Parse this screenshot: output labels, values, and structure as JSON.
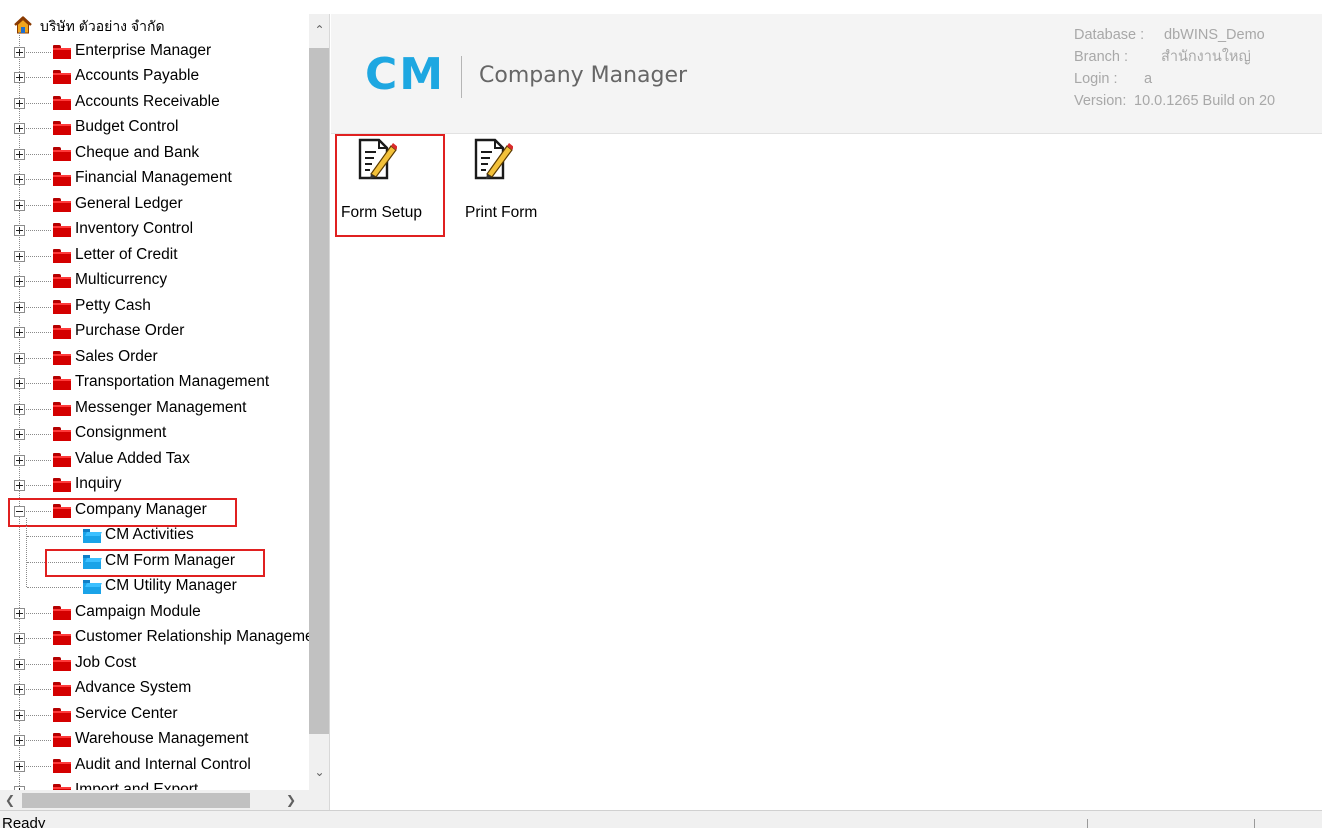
{
  "tree": {
    "root_label": "บริษัท ตัวอย่าง จำกัด",
    "items": [
      {
        "label": "Enterprise Manager",
        "state": "collapsed"
      },
      {
        "label": "Accounts Payable",
        "state": "collapsed"
      },
      {
        "label": "Accounts Receivable",
        "state": "collapsed"
      },
      {
        "label": "Budget Control",
        "state": "collapsed"
      },
      {
        "label": "Cheque and Bank",
        "state": "collapsed"
      },
      {
        "label": "Financial Management",
        "state": "collapsed"
      },
      {
        "label": "General Ledger",
        "state": "collapsed"
      },
      {
        "label": "Inventory Control",
        "state": "collapsed"
      },
      {
        "label": "Letter of Credit",
        "state": "collapsed"
      },
      {
        "label": "Multicurrency",
        "state": "collapsed"
      },
      {
        "label": "Petty Cash",
        "state": "collapsed"
      },
      {
        "label": "Purchase Order",
        "state": "collapsed"
      },
      {
        "label": "Sales Order",
        "state": "collapsed"
      },
      {
        "label": "Transportation Management",
        "state": "collapsed"
      },
      {
        "label": "Messenger Management",
        "state": "collapsed"
      },
      {
        "label": "Consignment",
        "state": "collapsed"
      },
      {
        "label": "Value Added Tax",
        "state": "collapsed"
      },
      {
        "label": "Inquiry",
        "state": "collapsed"
      },
      {
        "label": "Company Manager",
        "state": "expanded",
        "highlighted": true,
        "children": [
          {
            "label": "CM Activities"
          },
          {
            "label": "CM Form Manager",
            "highlighted": true
          },
          {
            "label": "CM Utility Manager"
          }
        ]
      },
      {
        "label": "Campaign Module",
        "state": "collapsed"
      },
      {
        "label": "Customer Relationship Management",
        "state": "collapsed"
      },
      {
        "label": "Job Cost",
        "state": "collapsed"
      },
      {
        "label": "Advance System",
        "state": "collapsed"
      },
      {
        "label": "Service Center",
        "state": "collapsed"
      },
      {
        "label": "Warehouse Management",
        "state": "collapsed"
      },
      {
        "label": "Audit and Internal Control",
        "state": "collapsed"
      },
      {
        "label": "Import and Export",
        "state": "collapsed"
      }
    ]
  },
  "header": {
    "logo": "CM",
    "module_name": "Company Manager",
    "info": [
      {
        "key": "Database :",
        "value": "dbWINS_Demo"
      },
      {
        "key": "Branch :",
        "value": "สำนักงานใหญ่"
      },
      {
        "key": "Login :",
        "value": "a"
      },
      {
        "key": "Version:",
        "value": "10.0.1265  Build on 20"
      }
    ]
  },
  "tools": [
    {
      "label": "Form Setup",
      "icon": "form-edit-icon",
      "highlighted": true
    },
    {
      "label": "Print Form",
      "icon": "form-edit-icon",
      "highlighted": false
    }
  ],
  "status": {
    "text": "Ready"
  },
  "colors": {
    "highlight": "#e02020",
    "brand": "#1ea7e1",
    "folder_red": "#d40000",
    "folder_blue": "#1aa3e8"
  }
}
